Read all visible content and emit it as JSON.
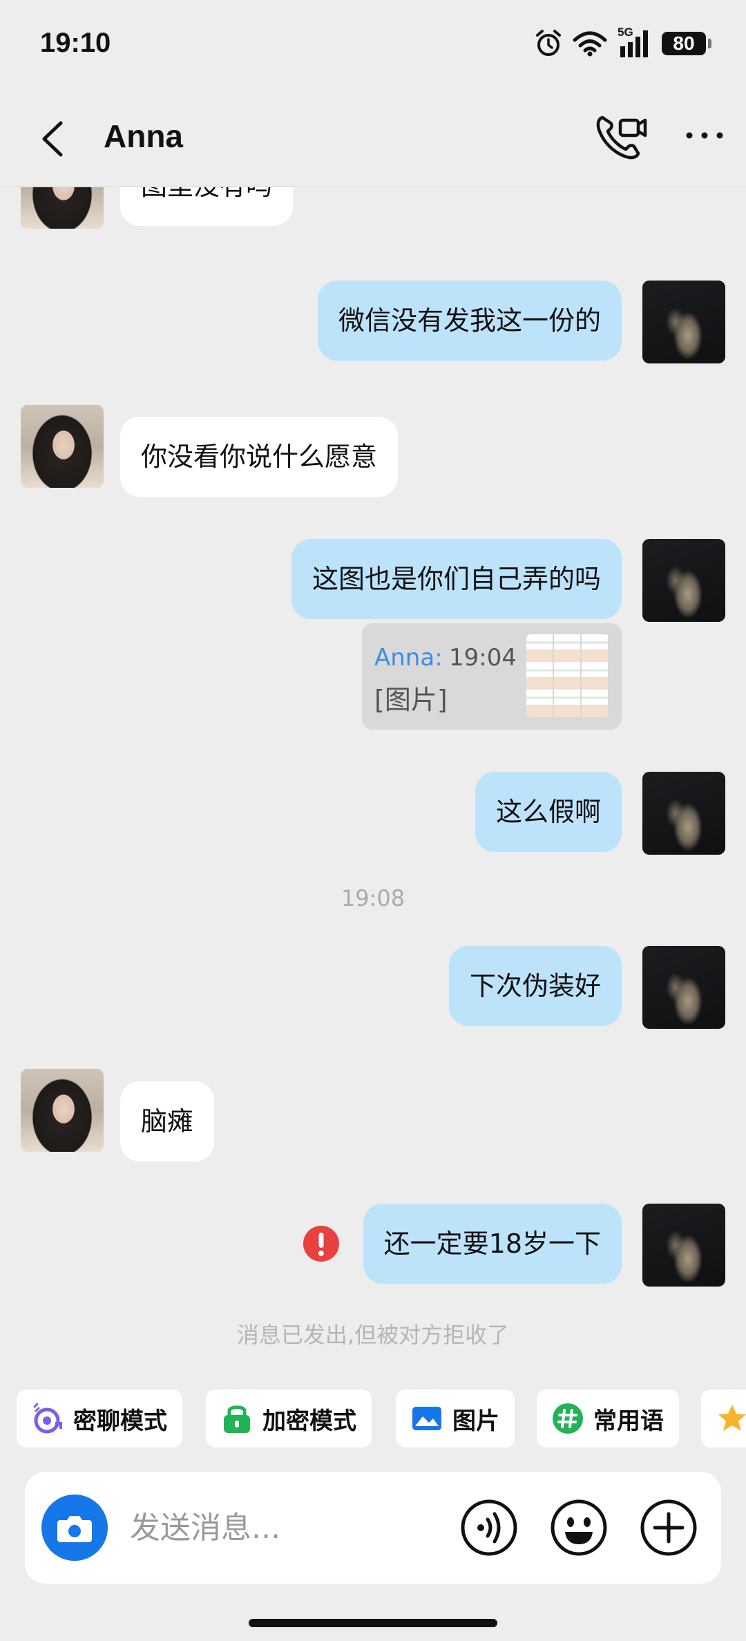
{
  "status_bar": {
    "time": "19:10",
    "network": "5G",
    "battery": "80"
  },
  "header": {
    "title": "Anna",
    "back_icon": "back-arrow-icon",
    "call_icon": "video-call-icon",
    "more_icon": "more-icon"
  },
  "messages": [
    {
      "direction": "in",
      "text": "图里没有吗"
    },
    {
      "direction": "out",
      "text": "微信没有发我这一份的"
    },
    {
      "direction": "in",
      "text": "你没看你说什么愿意"
    },
    {
      "direction": "out",
      "text": "这图也是你们自己弄的吗",
      "quote": {
        "name": "Anna:",
        "time": "19:04",
        "text": "[图片]"
      }
    },
    {
      "direction": "out",
      "text": "这么假啊"
    },
    {
      "direction": "out",
      "text": "下次伪装好"
    },
    {
      "direction": "in",
      "text": "脑瘫"
    },
    {
      "direction": "out",
      "text": "还一定要18岁一下",
      "status": "failed"
    }
  ],
  "timestamp": "19:08",
  "system_note": "消息已发出,但被对方拒收了",
  "quick_actions": [
    {
      "label": "密聊模式",
      "icon": "private-chat-icon"
    },
    {
      "label": "加密模式",
      "icon": "lock-icon"
    },
    {
      "label": "图片",
      "icon": "image-icon"
    },
    {
      "label": "常用语",
      "icon": "hashtag-icon"
    },
    {
      "label": "",
      "icon": "star-icon"
    }
  ],
  "input": {
    "placeholder": "发送消息..."
  },
  "colors": {
    "background": "#ededed",
    "outgoing_bubble": "#bde3fb",
    "incoming_bubble": "#ffffff",
    "accent": "#1677e8",
    "error": "#e8413f",
    "quote_name": "#3a8ee6"
  }
}
